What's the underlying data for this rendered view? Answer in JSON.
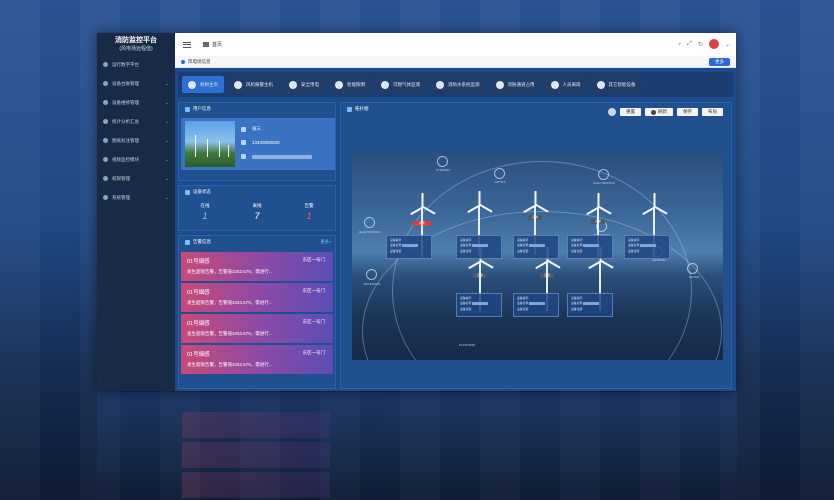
{
  "app": {
    "title": "消防监控平台",
    "subtitle": "(风电场远程值)"
  },
  "sidebar": {
    "items": [
      {
        "label": "运行数字平台"
      },
      {
        "label": "设备台账管理"
      },
      {
        "label": "设备维修管理"
      },
      {
        "label": "统计分析汇总"
      },
      {
        "label": "图纸标注管理"
      },
      {
        "label": "视频监控模块"
      },
      {
        "label": "权限管理"
      },
      {
        "label": "系统管理"
      }
    ]
  },
  "topbar": {
    "breadcrumb": "首页"
  },
  "tabbar": {
    "home_tab": "风电场信息",
    "ops_button": "更多"
  },
  "nav": {
    "buttons": [
      {
        "label": "机构主页",
        "active": true
      },
      {
        "label": "风机报警主机"
      },
      {
        "label": "安全用电"
      },
      {
        "label": "智能照明"
      },
      {
        "label": "可燃气体监测"
      },
      {
        "label": "消防水系统监测"
      },
      {
        "label": "消防通道占用"
      },
      {
        "label": "人员离岗"
      },
      {
        "label": "其它智能设备"
      }
    ]
  },
  "user_panel": {
    "title": "用户信息",
    "name": "张三",
    "phone": "13400000000"
  },
  "status_panel": {
    "title": "设备状态",
    "cols": [
      {
        "label": "在线",
        "value": "1"
      },
      {
        "label": "离线",
        "value": "7"
      },
      {
        "label": "告警",
        "value": "1"
      }
    ]
  },
  "alarm_panel": {
    "title": "告警信息",
    "more": "更多>",
    "items": [
      {
        "name": "01号烟感",
        "district": "东区一号门",
        "message": "发生超限告警，告警值3253.679，需进行..."
      },
      {
        "name": "01号烟感",
        "district": "东区一号门",
        "message": "发生超限告警，告警值3253.679，需进行..."
      },
      {
        "name": "01号烟感",
        "district": "东区一号门",
        "message": "发生超限告警，告警值3253.679，需进行..."
      },
      {
        "name": "01号烟感",
        "district": "东区一号门",
        "message": "发生超限告警，告警值3253.679，需进行..."
      }
    ]
  },
  "topo_panel": {
    "title": "拓扑图",
    "buttons": [
      {
        "label": "重置"
      },
      {
        "label": "刷新"
      },
      {
        "label": "保存"
      },
      {
        "label": "布局"
      }
    ],
    "nodes": [
      "SYSTEMS",
      "OPTICS",
      "ELECTRONICS",
      "ELECTRONICS",
      "MATERIALS",
      "SENSING",
      "CLOUD",
      "MATERIALS",
      "PLATFORM"
    ],
    "alarm_tag": "报警",
    "normal_tag": "正常",
    "info_lines": [
      "设备编号:",
      "设备名称:",
      "设备位置:"
    ]
  },
  "colors": {
    "accent": "#2e6fd2",
    "alarm": "#e03a3a",
    "panel": "#20508f"
  }
}
